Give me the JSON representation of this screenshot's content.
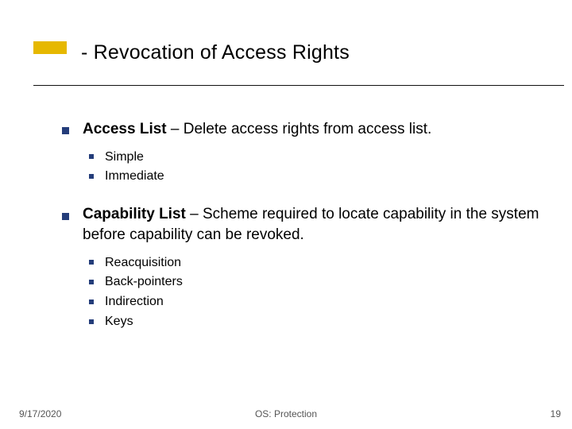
{
  "title": "- Revocation of Access Rights",
  "items": [
    {
      "lead": "Access List",
      "rest": " – Delete access rights from access list.",
      "subs": [
        "Simple",
        "Immediate"
      ]
    },
    {
      "lead": "Capability List",
      "rest": " – Scheme required to locate capability in the system before capability can be revoked.",
      "subs": [
        "Reacquisition",
        "Back-pointers",
        "Indirection",
        "Keys"
      ]
    }
  ],
  "footer": {
    "date": "9/17/2020",
    "center": "OS: Protection",
    "page": "19"
  }
}
